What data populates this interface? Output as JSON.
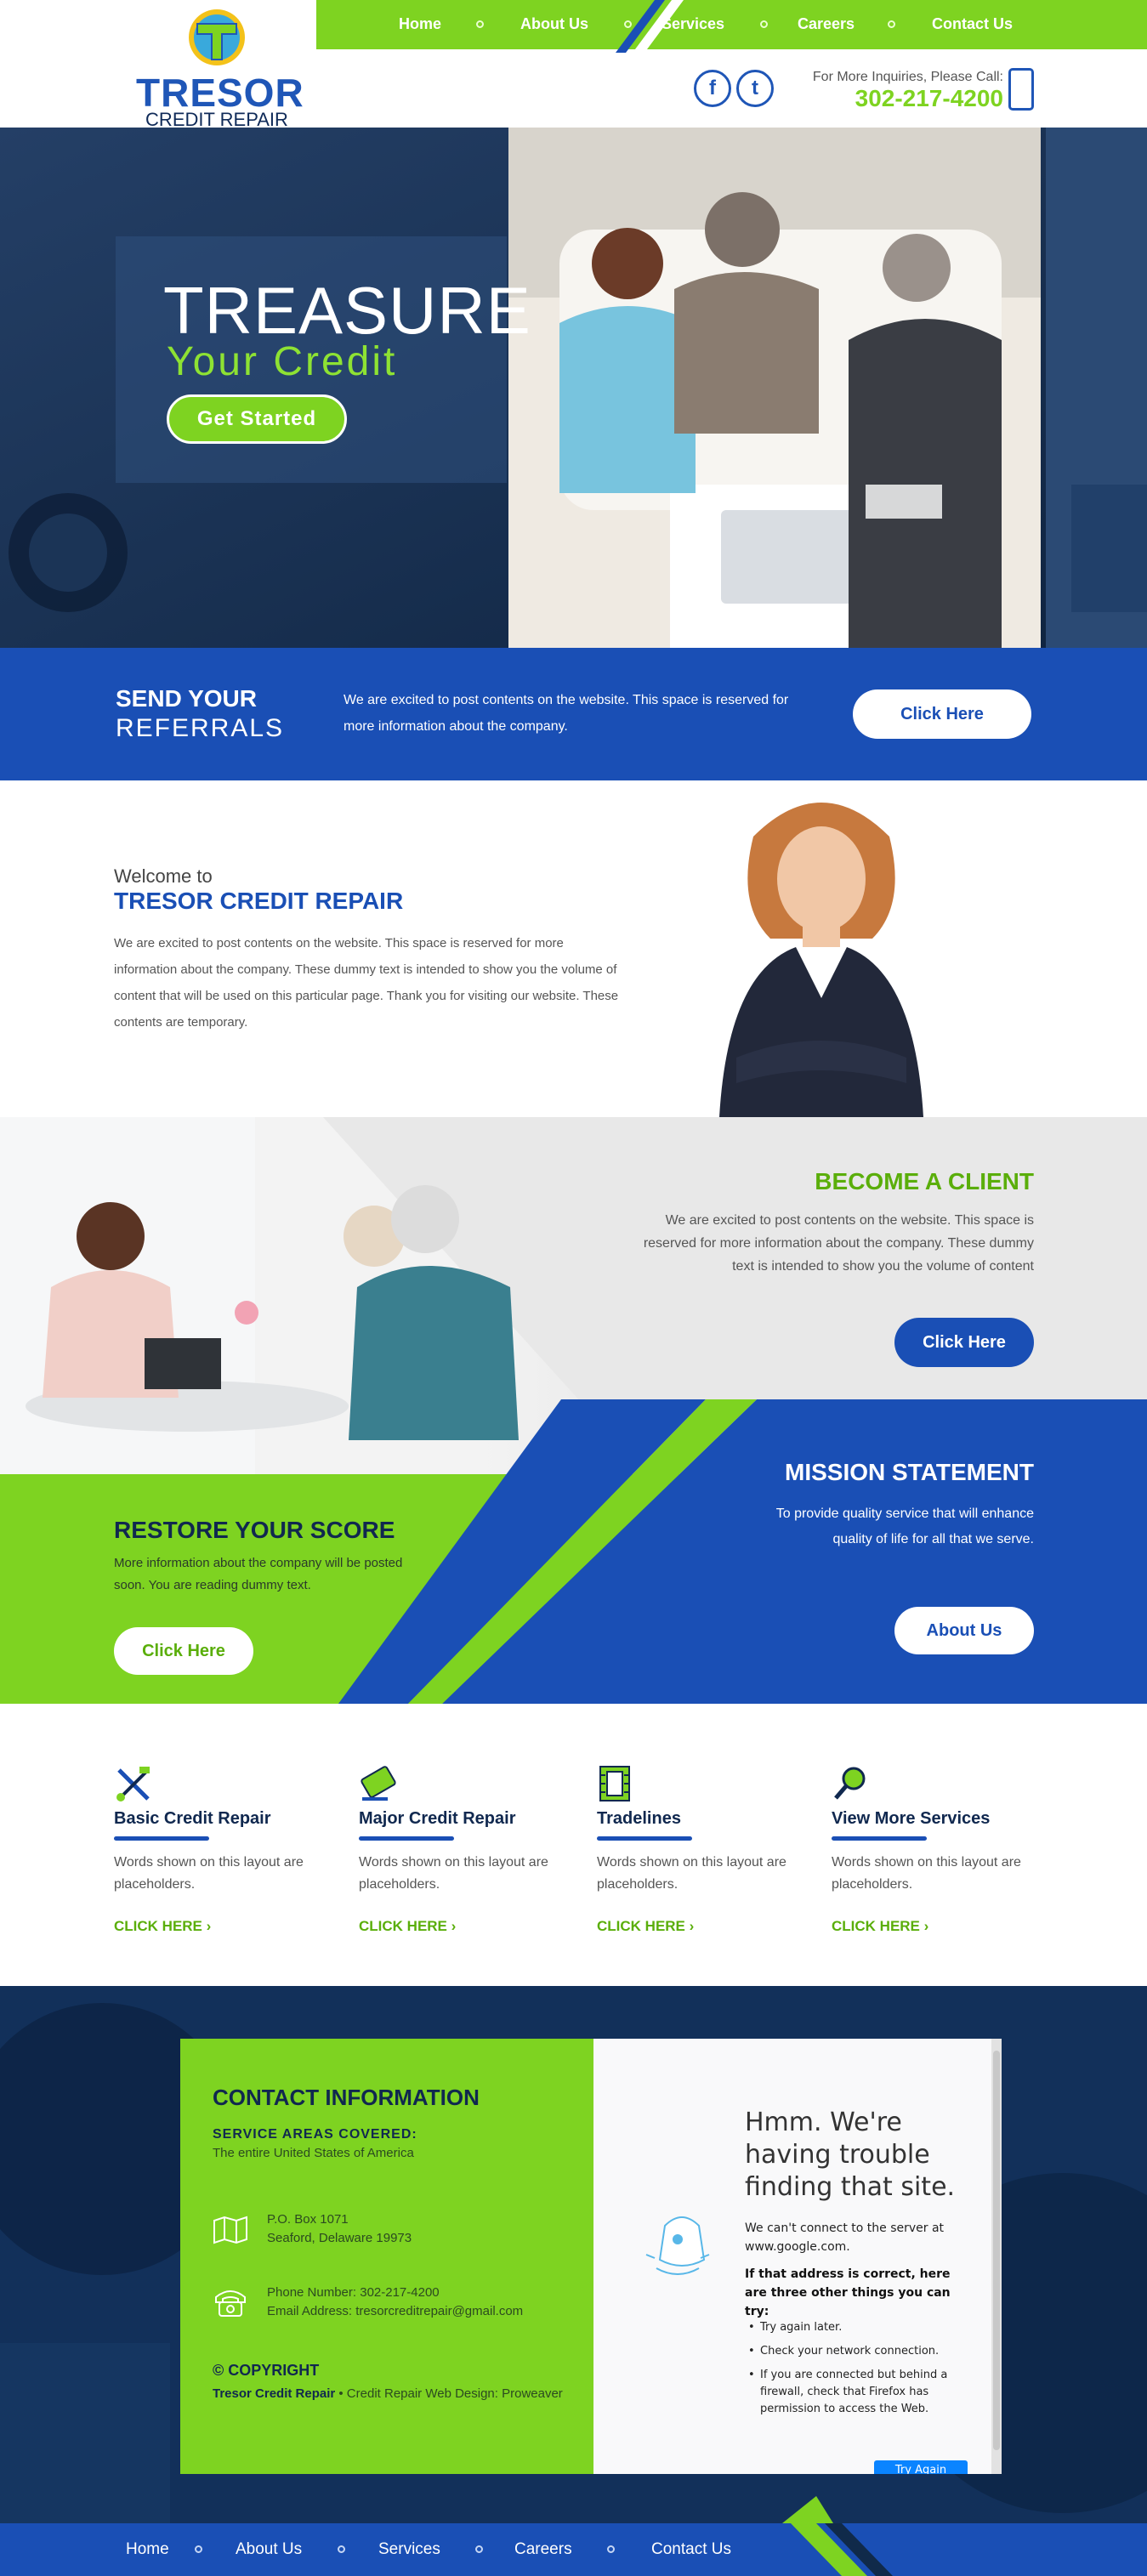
{
  "brand": {
    "name": "TRESOR",
    "tagline": "CREDIT REPAIR",
    "logo_letter": "T"
  },
  "nav": {
    "items": [
      "Home",
      "About Us",
      "Services",
      "Careers",
      "Contact Us"
    ]
  },
  "header": {
    "social": [
      {
        "label": "f",
        "icon": "facebook-icon"
      },
      {
        "label": "t",
        "icon": "twitter-icon"
      }
    ],
    "inquiry_label": "For More Inquiries, Please Call:",
    "phone": "302-217-4200"
  },
  "hero": {
    "title": "TREASURE",
    "subtitle": "Your Credit",
    "button": "Get Started"
  },
  "referrals": {
    "title_line1": "SEND YOUR",
    "title_line2": "REFERRALS",
    "body": "We are excited to post contents on the website. This space is reserved for more information about the company.",
    "button": "Click Here"
  },
  "welcome": {
    "small": "Welcome to",
    "title": "TRESOR CREDIT REPAIR",
    "body": "We are excited to post contents on the website. This space is reserved for more information about the company. These dummy text is intended to show you the volume of content that will be used on this particular page. Thank you for visiting our website. These contents are temporary."
  },
  "become_client": {
    "title": "BECOME A CLIENT",
    "body": "We are excited to post contents on the website. This space is reserved for more information about the company. These dummy text is intended to show you the volume of content",
    "button": "Click Here"
  },
  "restore": {
    "title": "RESTORE YOUR SCORE",
    "body": "More information about the company will be posted soon. You are reading dummy text.",
    "button": "Click Here"
  },
  "mission": {
    "title": "MISSION STATEMENT",
    "body": "To provide quality service that will enhance quality of life for all that we serve.",
    "button": "About Us"
  },
  "services": [
    {
      "name": "Basic Credit Repair",
      "body": "Words shown on this layout are placeholders.",
      "link": "CLICK HERE ›",
      "icon": "tools-icon"
    },
    {
      "name": "Major Credit Repair",
      "body": "Words shown on this layout are placeholders.",
      "link": "CLICK HERE ›",
      "icon": "credit-card-icon"
    },
    {
      "name": "Tradelines",
      "body": "Words shown on this layout are placeholders.",
      "link": "CLICK HERE ›",
      "icon": "film-strip-icon"
    },
    {
      "name": "View More Services",
      "body": "Words shown on this layout are placeholders.",
      "link": "CLICK HERE ›",
      "icon": "magnifier-icon"
    }
  ],
  "contact": {
    "title": "CONTACT INFORMATION",
    "areas_label": "SERVICE AREAS COVERED:",
    "areas_value": "The entire United States of America",
    "address_line1": "P.O. Box 1071",
    "address_line2": "Seaford, Delaware 19973",
    "phone_line": "Phone Number: 302-217-4200",
    "email_line": "Email Address: tresorcreditrepair@gmail.com",
    "copyright": "© COPYRIGHT",
    "credit_company": "Tresor Credit Repair",
    "credit_rest": " • Credit Repair Web Design: Proweaver"
  },
  "error_frame": {
    "heading": "Hmm. We're having trouble finding that site.",
    "para": "We can't connect to the server at www.google.com.",
    "bold": "If that address is correct, here are three other things you can try:",
    "list": [
      "Try again later.",
      "Check your network connection.",
      "If you are connected but behind a firewall, check that Firefox has permission to access the Web."
    ],
    "button": "Try Again"
  },
  "colors": {
    "green": "#7ed321",
    "blue": "#1a4fb5",
    "navy": "#10284f"
  }
}
